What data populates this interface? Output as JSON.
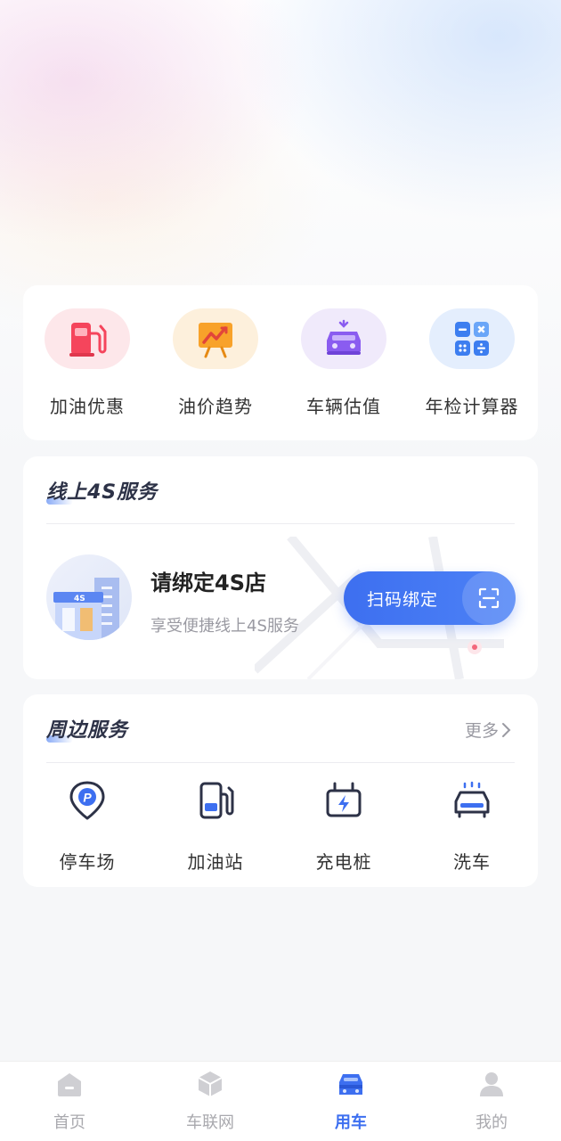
{
  "tools": [
    {
      "label": "加油优惠",
      "icon": "fuel-pump-icon",
      "bg": "#fde7ea"
    },
    {
      "label": "油价趋势",
      "icon": "trend-chart-icon",
      "bg": "#fdf0dc"
    },
    {
      "label": "车辆估值",
      "icon": "car-valuation-icon",
      "bg": "#f0eafb"
    },
    {
      "label": "年检计算器",
      "icon": "calculator-icon",
      "bg": "#e4eefd"
    }
  ],
  "online4s": {
    "title": "线上4S服务",
    "bind_title": "请绑定4S店",
    "bind_subtitle": "享受便捷线上4S服务",
    "scan_button": "扫码绑定",
    "avatar_badge": "4S"
  },
  "nearby": {
    "title": "周边服务",
    "more": "更多",
    "items": [
      {
        "label": "停车场",
        "icon": "parking-icon"
      },
      {
        "label": "加油站",
        "icon": "gas-station-icon"
      },
      {
        "label": "充电桩",
        "icon": "charging-pile-icon"
      },
      {
        "label": "洗车",
        "icon": "car-wash-icon"
      }
    ]
  },
  "tabbar": {
    "active": "用车",
    "tabs": [
      {
        "label": "首页",
        "icon": "home-icon"
      },
      {
        "label": "车联网",
        "icon": "cube-icon"
      },
      {
        "label": "用车",
        "icon": "car-icon"
      },
      {
        "label": "我的",
        "icon": "user-icon"
      }
    ]
  },
  "colors": {
    "accent": "#3d6ff0",
    "title": "#2d3247",
    "muted": "#9a9aa2"
  }
}
